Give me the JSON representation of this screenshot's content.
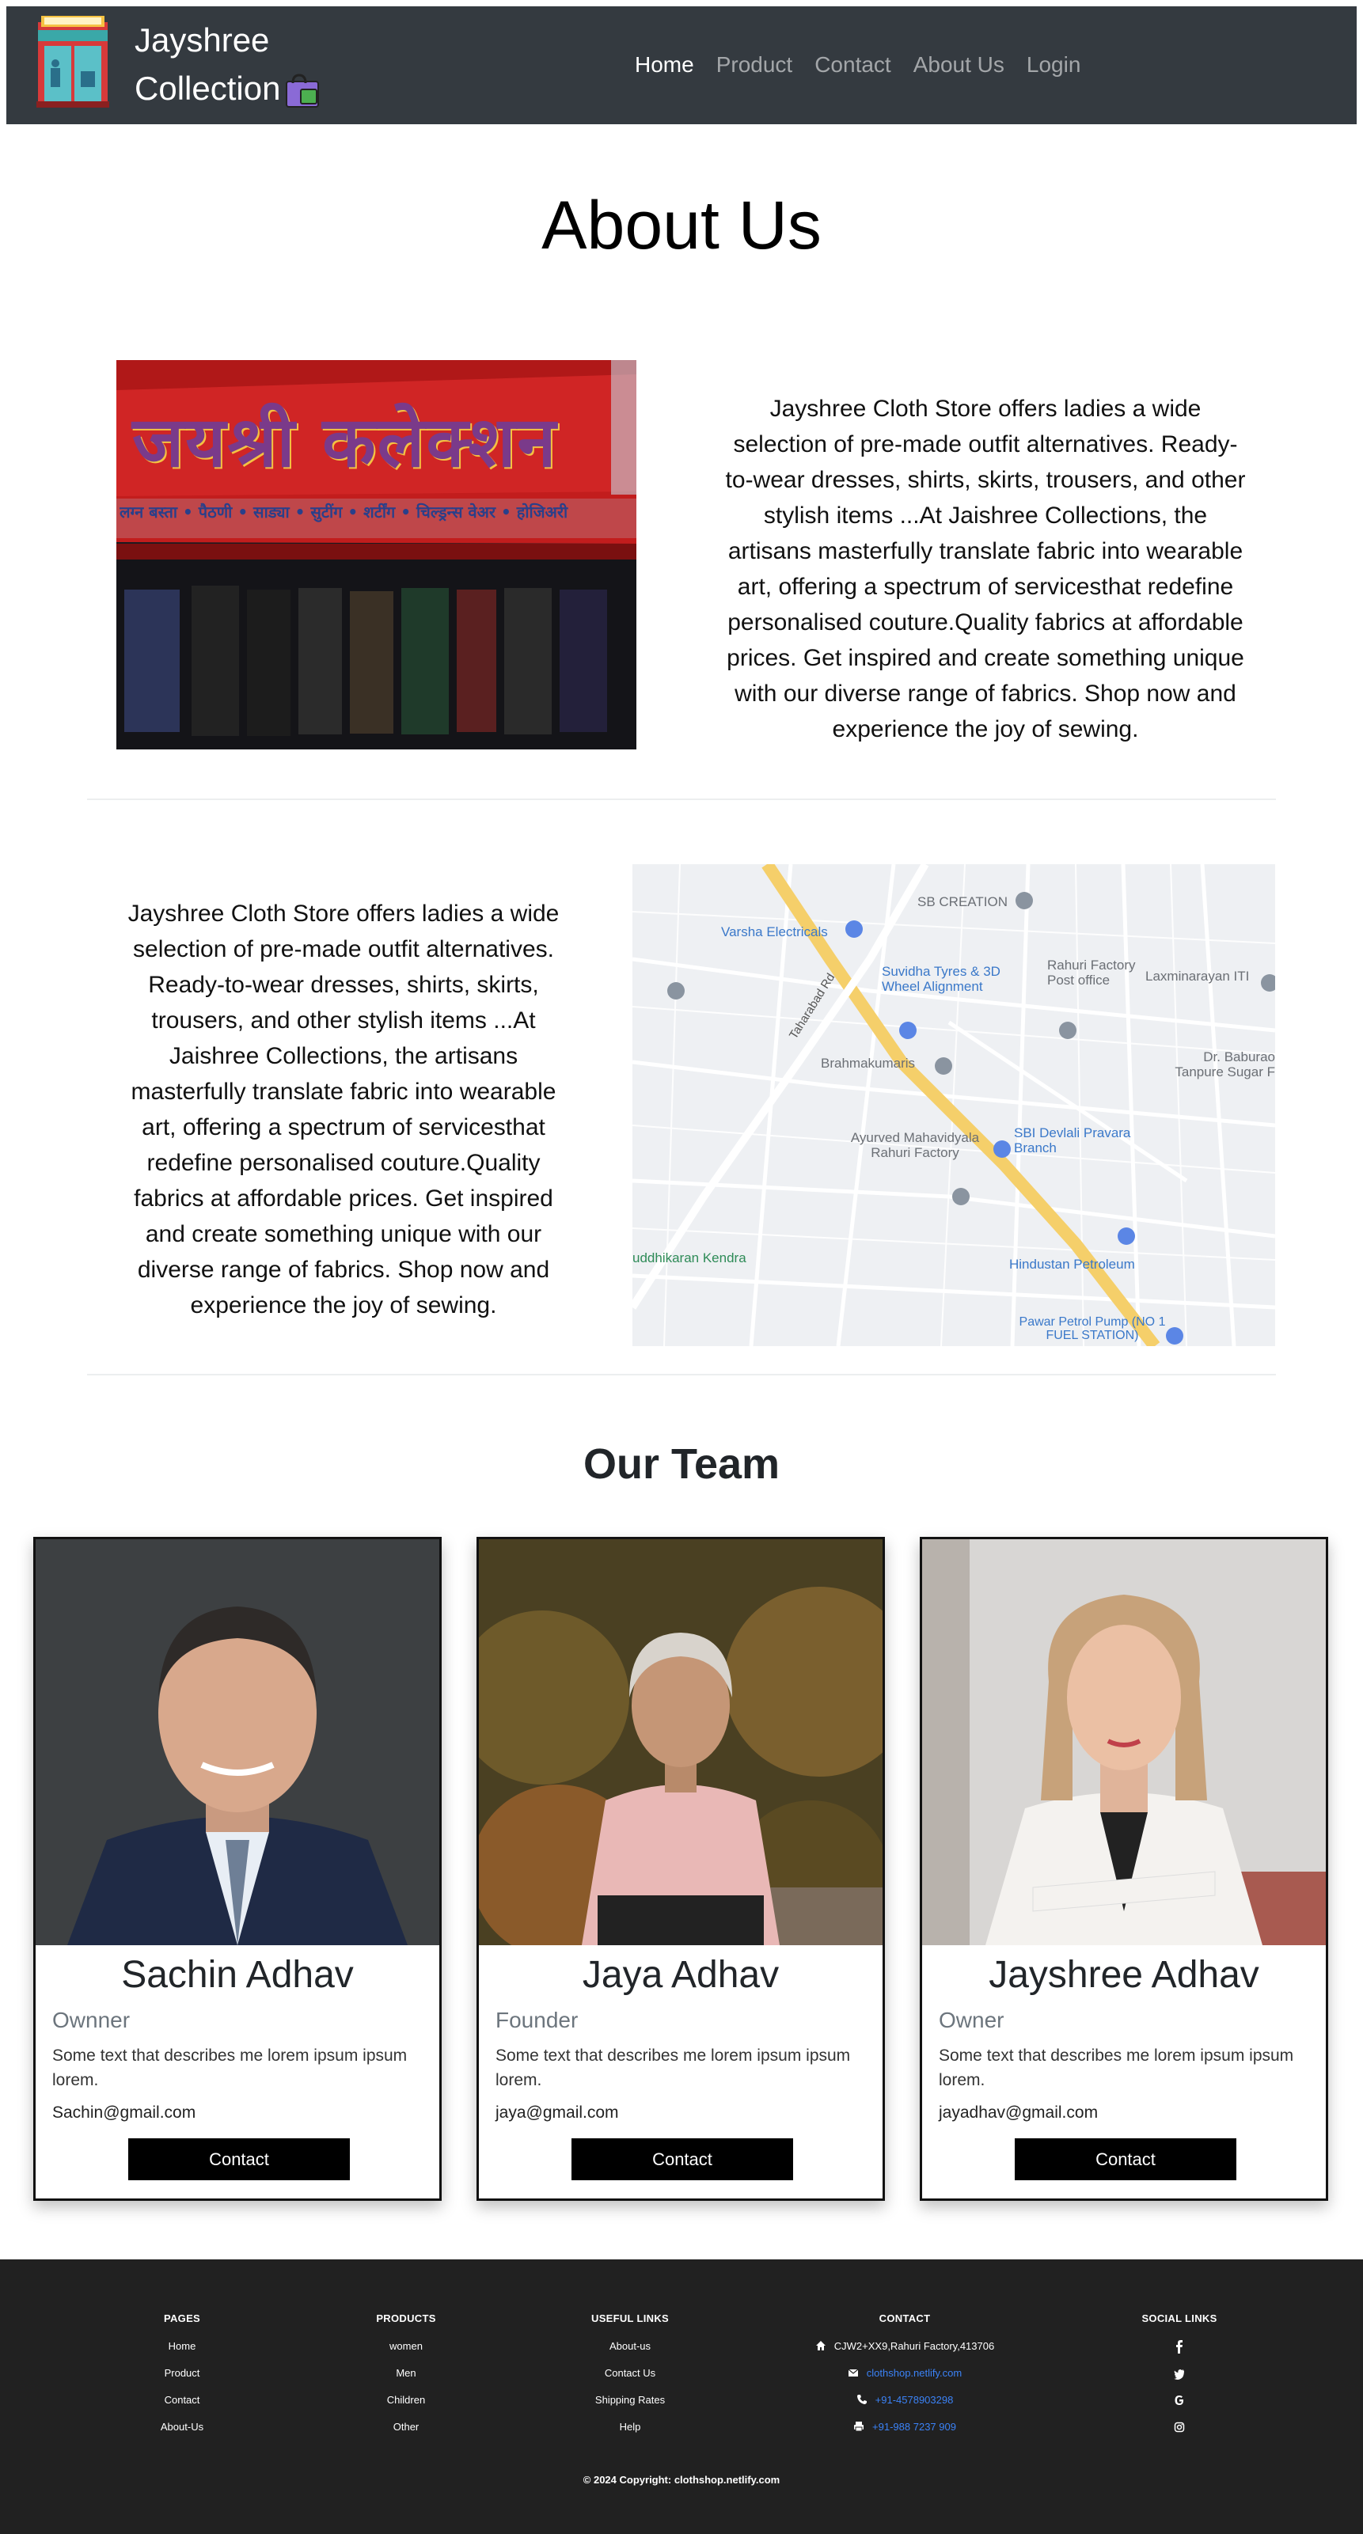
{
  "navbar": {
    "brand_line1": "Jayshree",
    "brand_line2": "Collection",
    "links": [
      "Home",
      "Product",
      "Contact",
      "About Us",
      "Login"
    ],
    "active": "Home"
  },
  "about": {
    "title": "About Us",
    "paragraph": "Jayshree Cloth Store offers ladies a wide selection of pre-made outfit alternatives. Ready-to-wear dresses, shirts, skirts, trousers, and other stylish items ...At Jaishree Collections, the artisans masterfully translate fabric into wearable art, offering a spectrum of servicesthat redefine personalised couture.Quality fabrics at affordable prices. Get inspired and create something unique with our diverse range of fabrics. Shop now and experience the joy of sewing.",
    "store_sign_text": "जयश्री कलेक्शन",
    "store_sign_subtext": "लग्न बस्ता • पैठणी • साड्या • सुटींग • शर्टींग • चिल्ड्रन्स वेअर • होजिअरी"
  },
  "map": {
    "labels": [
      "Varsha Electricals",
      "SB CREATION",
      "Suvidha Tyres & 3D Wheel Alignment",
      "Rahuri Factory Post office",
      "Laxminarayan ITI",
      "Taharabad Rd",
      "Brahmakumaris",
      "Dr. Baburao Tanpure Sugar F",
      "Ayurved Mahavidyala Rahuri Factory",
      "SBI Devlali Pravara Branch",
      "Hindustan Petroleum",
      "uddhikaran Kendra",
      "Pawar Petrol Pump (NO 1 FUEL STATION)"
    ]
  },
  "team": {
    "title": "Our Team",
    "members": [
      {
        "name": "Sachin Adhav",
        "role": "Ownner",
        "description": "Some text that describes me lorem ipsum ipsum lorem.",
        "email": "Sachin@gmail.com",
        "button": "Contact"
      },
      {
        "name": "Jaya Adhav",
        "role": "Founder",
        "description": "Some text that describes me lorem ipsum ipsum lorem.",
        "email": "jaya@gmail.com",
        "button": "Contact"
      },
      {
        "name": "Jayshree Adhav",
        "role": "Owner",
        "description": "Some text that describes me lorem ipsum ipsum lorem.",
        "email": "jayadhav@gmail.com",
        "button": "Contact"
      }
    ]
  },
  "footer": {
    "pages": {
      "title": "PAGES",
      "items": [
        "Home",
        "Product",
        "Contact",
        "About-Us"
      ]
    },
    "products": {
      "title": "PRODUCTS",
      "items": [
        "women",
        "Men",
        "Children",
        "Other"
      ]
    },
    "useful_links": {
      "title": "USEFUL LINKS",
      "items": [
        "About-us",
        "Contact Us",
        "Shipping Rates",
        "Help"
      ]
    },
    "contact": {
      "title": "CONTACT",
      "address": "CJW2+XX9,Rahuri Factory,413706",
      "email": "clothshop.netlify.com",
      "phone": "+91-4578903298",
      "fax": "+91-988 7237 909"
    },
    "social": {
      "title": "SOCIAL LINKS",
      "icons": [
        "facebook-icon",
        "twitter-icon",
        "google-icon",
        "instagram-icon"
      ]
    },
    "copyright": "© 2024 Copyright: clothshop.netlify.com"
  },
  "colors": {
    "navbar_bg": "#343a40",
    "footer_bg": "#212121",
    "button_bg": "#000000",
    "link_blue": "#3b82f6"
  }
}
